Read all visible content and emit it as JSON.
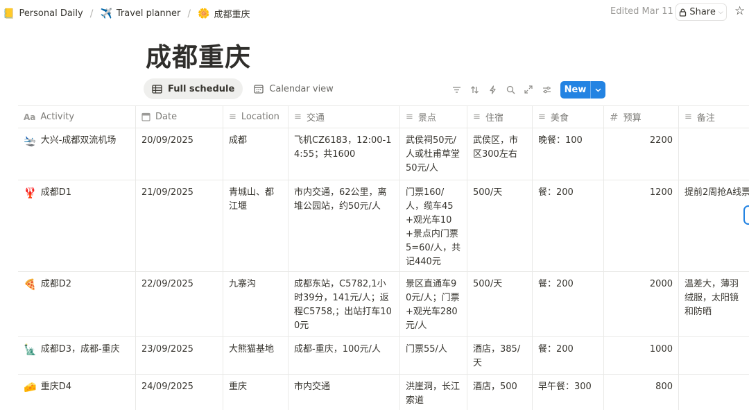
{
  "breadcrumb": [
    {
      "icon": "📒",
      "label": "Personal Daily"
    },
    {
      "icon": "✈️",
      "label": "Travel planner"
    },
    {
      "icon": "🌼",
      "label": "成都重庆"
    }
  ],
  "edited": "Edited Mar 11",
  "share_label": "Share",
  "page_title": "成都重庆",
  "tabs": [
    {
      "label": "Full schedule",
      "icon": "table-icon",
      "active": true
    },
    {
      "label": "Calendar view",
      "icon": "calendar-icon",
      "active": false
    }
  ],
  "new_label": "New",
  "accent_color": "#2383e2",
  "columns": [
    {
      "icon": "text-aa-icon",
      "label": "Activity"
    },
    {
      "icon": "calendar-icon",
      "label": "Date"
    },
    {
      "icon": "text-lines-icon",
      "label": "Location"
    },
    {
      "icon": "text-lines-icon",
      "label": "交通"
    },
    {
      "icon": "text-lines-icon",
      "label": "景点"
    },
    {
      "icon": "text-lines-icon",
      "label": "住宿"
    },
    {
      "icon": "text-lines-icon",
      "label": "美食"
    },
    {
      "icon": "hash-icon",
      "label": "预算"
    },
    {
      "icon": "text-lines-icon",
      "label": "备注"
    }
  ],
  "rows": [
    {
      "emoji": "🛬",
      "activity": "大兴-成都双流机场",
      "date": "20/09/2025",
      "location": "成都",
      "transport": "飞机CZ6183，12:00-14:55；共1600",
      "sights": "武侯祠50元/人或杜甫草堂50元/人",
      "lodging": "武侯区，市区300左右",
      "food": "晚餐：100",
      "budget": "2200",
      "notes": ""
    },
    {
      "emoji": "🦞",
      "activity": "成都D1",
      "date": "21/09/2025",
      "location": "青城山、都江堰",
      "transport": "市内交通，62公里，离堆公园站，约50元/人",
      "sights": "门票160/人，缆车45+观光车10+景点内门票5=60/人，共记440元",
      "lodging": "500/天",
      "food": "餐：200",
      "budget": "1200",
      "notes": "提前2周抢A线票"
    },
    {
      "emoji": "🍕",
      "activity": "成都D2",
      "date": "22/09/2025",
      "location": "九寨沟",
      "transport": "成都东站，C5782,1小时39分，141元/人；返程C5758,；出站打车100元",
      "sights": "景区直通车90元/人；门票+观光车280元/人",
      "lodging": "500/天",
      "food": "餐：200",
      "budget": "2000",
      "notes": "温差大，薄羽绒服，太阳镜和防晒"
    },
    {
      "emoji": "🗽",
      "activity": "成都D3，成都-重庆",
      "date": "23/09/2025",
      "location": "大熊猫基地",
      "transport": "成都-重庆，100元/人",
      "sights": "门票55/人",
      "lodging": "酒店，385/天",
      "food": "餐：200",
      "budget": "1000",
      "notes": ""
    },
    {
      "emoji": "🧀",
      "activity": "重庆D4",
      "date": "24/09/2025",
      "location": "重庆",
      "transport": "市内交通",
      "sights": "洪崖洞，长江索道",
      "lodging": "酒店，500",
      "food": "早午餐：300",
      "budget": "800",
      "notes": ""
    }
  ]
}
